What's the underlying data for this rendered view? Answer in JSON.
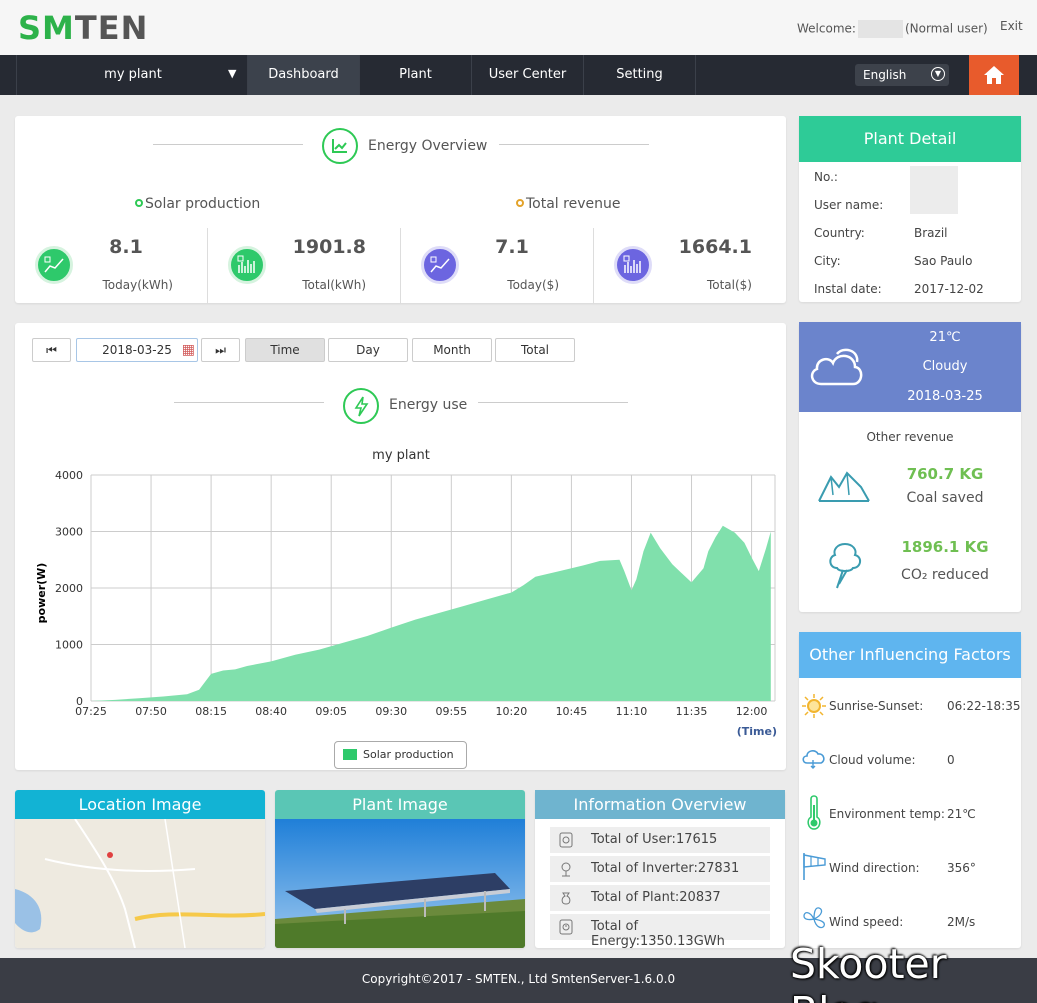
{
  "header": {
    "logo_part1": "SM",
    "logo_part2": "TEN",
    "welcome_label": "Welcome:",
    "user_role": "(Normal user)",
    "exit_label": "Exit"
  },
  "nav": {
    "plant_select": "my plant",
    "items": [
      {
        "label": "Dashboard",
        "active": true
      },
      {
        "label": "Plant",
        "active": false
      },
      {
        "label": "User Center",
        "active": false
      },
      {
        "label": "Setting",
        "active": false
      }
    ],
    "language": "English"
  },
  "energy_overview": {
    "title": "Energy Overview",
    "solar_production_label": "Solar production",
    "total_revenue_label": "Total revenue",
    "stats": [
      {
        "value": "8.1",
        "unit": "Today(kWh)"
      },
      {
        "value": "1901.8",
        "unit": "Total(kWh)"
      },
      {
        "value": "7.1",
        "unit": "Today($)"
      },
      {
        "value": "1664.1",
        "unit": "Total($)"
      }
    ]
  },
  "toolbar": {
    "date": "2018-03-25",
    "buttons": [
      "Time",
      "Day",
      "Month",
      "Total"
    ],
    "active": "Time"
  },
  "energy_use": {
    "title": "Energy use"
  },
  "chart_data": {
    "type": "area",
    "title": "my plant",
    "ylabel": "power(W)",
    "xlabel": "(Time)",
    "ylim": [
      0,
      4000
    ],
    "yticks": [
      "0",
      "1000",
      "2000",
      "3000",
      "4000"
    ],
    "xticks": [
      "07:25",
      "07:50",
      "08:15",
      "08:40",
      "09:05",
      "09:30",
      "09:55",
      "10:20",
      "10:45",
      "11:10",
      "11:35",
      "12:00"
    ],
    "series": [
      {
        "name": "Solar production",
        "color": "#80e0ac",
        "points": [
          [
            "07:25",
            0
          ],
          [
            "07:35",
            20
          ],
          [
            "07:45",
            50
          ],
          [
            "07:55",
            80
          ],
          [
            "08:05",
            120
          ],
          [
            "08:10",
            200
          ],
          [
            "08:15",
            480
          ],
          [
            "08:20",
            540
          ],
          [
            "08:25",
            560
          ],
          [
            "08:30",
            620
          ],
          [
            "08:40",
            700
          ],
          [
            "08:50",
            820
          ],
          [
            "09:00",
            910
          ],
          [
            "09:10",
            1030
          ],
          [
            "09:20",
            1150
          ],
          [
            "09:30",
            1300
          ],
          [
            "09:40",
            1440
          ],
          [
            "09:50",
            1560
          ],
          [
            "10:00",
            1680
          ],
          [
            "10:10",
            1800
          ],
          [
            "10:20",
            1920
          ],
          [
            "10:25",
            2050
          ],
          [
            "10:30",
            2200
          ],
          [
            "10:40",
            2300
          ],
          [
            "10:50",
            2400
          ],
          [
            "10:57",
            2480
          ],
          [
            "11:05",
            2500
          ],
          [
            "11:07",
            2300
          ],
          [
            "11:10",
            1960
          ],
          [
            "11:12",
            2150
          ],
          [
            "11:15",
            2650
          ],
          [
            "11:18",
            2980
          ],
          [
            "11:22",
            2700
          ],
          [
            "11:27",
            2420
          ],
          [
            "11:30",
            2300
          ],
          [
            "11:35",
            2100
          ],
          [
            "11:40",
            2350
          ],
          [
            "11:42",
            2650
          ],
          [
            "11:45",
            2900
          ],
          [
            "11:48",
            3100
          ],
          [
            "11:53",
            2980
          ],
          [
            "11:57",
            2800
          ],
          [
            "12:00",
            2540
          ],
          [
            "12:03",
            2300
          ],
          [
            "12:06",
            2700
          ],
          [
            "12:08",
            3000
          ]
        ]
      }
    ]
  },
  "plant_detail": {
    "title": "Plant Detail",
    "rows": [
      {
        "label": "No.:",
        "value": ""
      },
      {
        "label": "User name:",
        "value": ""
      },
      {
        "label": "Country:",
        "value": "Brazil"
      },
      {
        "label": "City:",
        "value": "Sao Paulo"
      },
      {
        "label": "Instal date:",
        "value": "2017-12-02"
      }
    ]
  },
  "weather": {
    "temp": "21℃",
    "condition": "Cloudy",
    "date": "2018-03-25",
    "other_revenue_label": "Other revenue",
    "coal_value": "760.7 KG",
    "coal_label": "Coal saved",
    "co2_value": "1896.1 KG",
    "co2_label": "CO₂ reduced",
    "accent": "#6fbf52"
  },
  "factors": {
    "title": "Other Influencing Factors",
    "rows": [
      {
        "label": "Sunrise-Sunset:",
        "value": "06:22-18:35",
        "icon": "sun-icon"
      },
      {
        "label": "Cloud volume:",
        "value": "0",
        "icon": "cloud-icon"
      },
      {
        "label": "Environment temp:",
        "value": "21℃",
        "icon": "thermometer-icon"
      },
      {
        "label": "Wind direction:",
        "value": "356°",
        "icon": "windsock-icon"
      },
      {
        "label": "Wind speed:",
        "value": "2M/s",
        "icon": "fan-icon"
      }
    ]
  },
  "panels": {
    "location_title": "Location Image",
    "plant_title": "Plant Image",
    "info_title": "Information Overview",
    "info_rows": [
      "Total of User:17615",
      "Total of Inverter:27831",
      "Total of Plant:20837",
      "Total of Energy:1350.13GWh"
    ]
  },
  "footer": {
    "copyright": "Copyright©2017 - SMTEN., Ltd SmtenServer-1.6.0.0"
  },
  "watermark": "Skooter Blog"
}
